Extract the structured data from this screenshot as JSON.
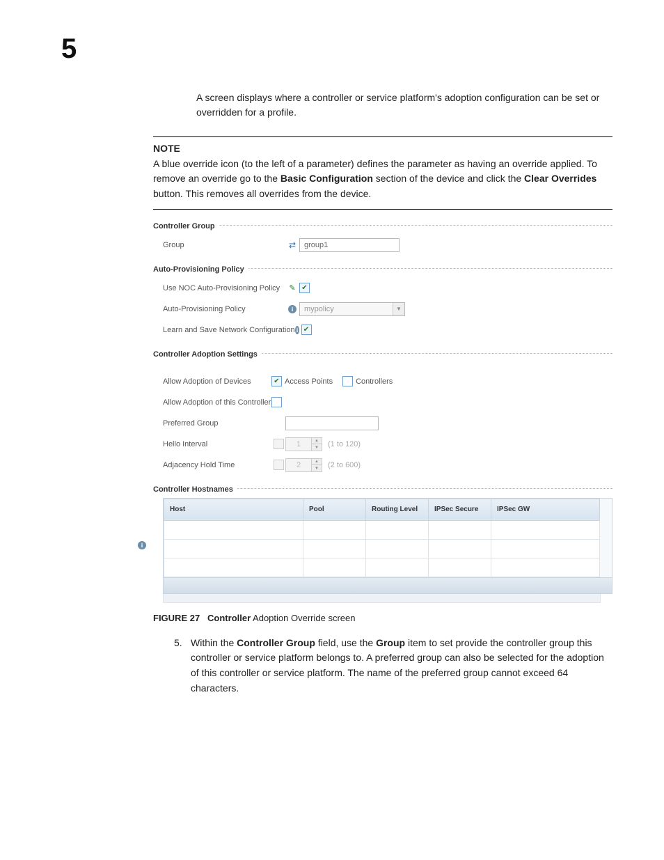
{
  "page": {
    "chapter_number": "5",
    "intro": "A screen displays where a controller or service platform's adoption configuration can be set or overridden for a profile.",
    "note": {
      "title": "NOTE",
      "l1a": "A blue override icon (to the left of a parameter) defines the parameter as having an override applied. To remove an override go to the ",
      "l1b": "Basic Configuration",
      "l1c": " section of the device and click the ",
      "l1d": "Clear Overrides",
      "l1e": " button. This removes all overrides from the device."
    },
    "figure": {
      "label": "FIGURE 27",
      "bold": "Controller",
      "rest": " Adoption Override screen"
    },
    "step5": {
      "num": "5.",
      "a": "Within the ",
      "b": "Controller Group",
      "c": " field, use the ",
      "d": "Group",
      "e": " item to set provide the controller group this controller or service platform belongs to. A preferred group can also be selected for the adoption of this controller or service platform. The name of the preferred group cannot exceed 64 characters."
    }
  },
  "ui": {
    "section_controller_group": "Controller Group",
    "group_label": "Group",
    "group_value": "group1",
    "section_auto_prov": "Auto-Provisioning Policy",
    "use_noc_label": "Use NOC Auto-Provisioning Policy",
    "auto_prov_policy_label": "Auto-Provisioning Policy",
    "auto_prov_policy_value": "mypolicy",
    "learn_save_label": "Learn and Save Network Configuration",
    "section_adopt": "Controller Adoption Settings",
    "allow_devices_label": "Allow Adoption of Devices",
    "access_points": "Access Points",
    "controllers": "Controllers",
    "allow_this_ctrl_label": "Allow Adoption of this Controller",
    "preferred_group_label": "Preferred Group",
    "hello_label": "Hello Interval",
    "hello_value": "1",
    "hello_range": "(1 to 120)",
    "adj_label": "Adjacency Hold Time",
    "adj_value": "2",
    "adj_range": "(2 to 600)",
    "section_hostnames": "Controller Hostnames",
    "table_h1": "Host",
    "table_h2": "Pool",
    "table_h3": "Routing Level",
    "table_h4": "IPSec Secure",
    "table_h5": "IPSec GW"
  }
}
